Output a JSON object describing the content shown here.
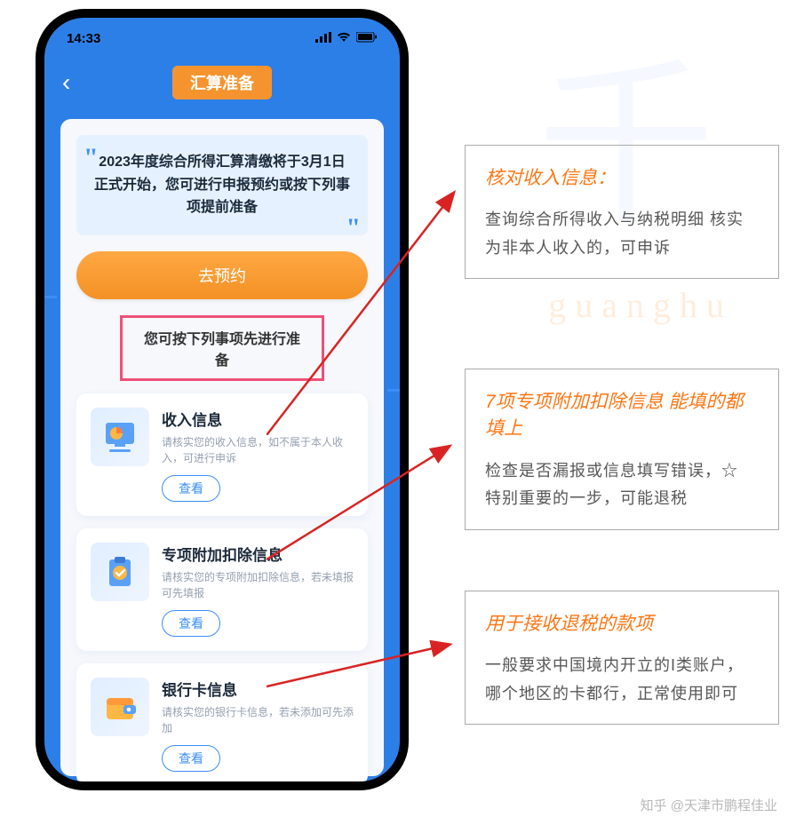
{
  "status": {
    "time": "14:33"
  },
  "header": {
    "title": "汇算准备"
  },
  "notice": "2023年度综合所得汇算清缴将于3月1日正式开始，您可进行申报预约或按下列事项提前准备",
  "appoint_label": "去预约",
  "prep_highlight": "您可按下列事项先进行准备",
  "items": [
    {
      "title": "收入信息",
      "desc": "请核实您的收入信息，如不属于本人收入，可进行申诉",
      "btn": "查看"
    },
    {
      "title": "专项附加扣除信息",
      "desc": "请核实您的专项附加扣除信息，若未填报可先填报",
      "btn": "查看"
    },
    {
      "title": "银行卡信息",
      "desc": "请核实您的银行卡信息，若未添加可先添加",
      "btn": "查看"
    }
  ],
  "annotations": [
    {
      "title": "核对收入信息：",
      "body": "查询综合所得收入与纳税明细 核实为非本人收入的，可申诉"
    },
    {
      "title": "7项专项附加扣除信息 能填的都填上",
      "body": "检查是否漏报或信息填写错误，☆ 特别重要的一步，可能退税"
    },
    {
      "title": "用于接收退税的款项",
      "body": "一般要求中国境内开立的I类账户，哪个地区的卡都行，正常使用即可"
    }
  ],
  "watermark": "知乎 @天津市鹏程佳业",
  "bg_text": "guanghu"
}
